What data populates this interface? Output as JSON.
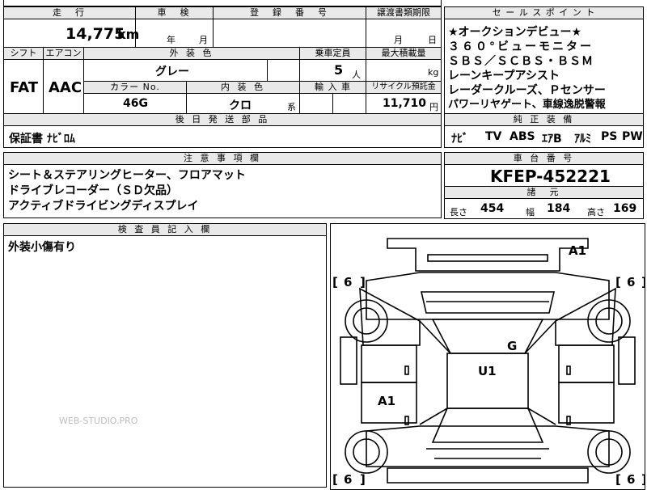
{
  "top_labels": {
    "mileage": "走　行",
    "inspection": "車　検",
    "registration": "登　録　番　号",
    "transfer_deadline": "譲渡書類期限",
    "sales_points": "セ ー ル ス ポ イ ン ト"
  },
  "top_values": {
    "mileage": "14,775",
    "mileage_unit": "km",
    "inspection_year": "年",
    "inspection_month": "月",
    "transfer_month": "月",
    "transfer_day": "日"
  },
  "row2_labels": {
    "shift": "シフト",
    "aircon": "エアコン",
    "exterior_color": "外 装 色",
    "capacity": "乗車定員",
    "max_load": "最大積載量"
  },
  "row2_values": {
    "shift": "FAT",
    "aircon": "AAC",
    "exterior_color": "グレー",
    "capacity": "5",
    "capacity_unit": "人",
    "max_load_unit": "kg"
  },
  "row3_labels": {
    "color_no": "カラー No.",
    "interior_color": "内 装 色",
    "import": "輸 入 車",
    "recycle": "リサイクル預託金"
  },
  "row3_values": {
    "color_no": "46G",
    "interior_color": "クロ",
    "interior_suffix": "系",
    "recycle": "11,710",
    "recycle_unit": "円"
  },
  "sales_points": [
    "★オークションデビュー★",
    "３６０°ビューモニター",
    "ＳＢＳ／ＳＣＢＳ・ＢＳＭ",
    "レーンキープアシスト",
    "レーダークルーズ、Ｐセンサー",
    "パワーリヤゲート、車線逸脱警報"
  ],
  "parts": {
    "label": "後 日 発 送 部 品",
    "value": "保証書 ﾅﾋﾞﾛﾑ"
  },
  "factory_equipment": {
    "label": "純 正 装 備",
    "items": [
      "ﾅﾋﾞ",
      "TV",
      "ABS",
      "ｴｱB",
      "ｱﾙﾐ",
      "PS",
      "PW"
    ]
  },
  "notes": {
    "label": "注 意 事 項 欄",
    "lines": [
      "シート＆ステアリングヒーター、フロアマット",
      "ドライブレコーダー（ＳＤ欠品）",
      "アクティブドライビングディスプレイ"
    ]
  },
  "chassis": {
    "label": "車 台 番 号",
    "value": "KFEP-452221"
  },
  "specs": {
    "label": "諸　元",
    "length_label": "長さ",
    "length": "454",
    "width_label": "幅",
    "width": "184",
    "height_label": "高さ",
    "height": "169"
  },
  "inspector": {
    "label": "検 査 員 記 入 欄",
    "comment": "外装小傷有り"
  },
  "watermark": "WEB-STUDIO.PRO",
  "diagram": {
    "marks": [
      {
        "code": "A1",
        "area": "rear-right"
      },
      {
        "code": "G",
        "area": "windshield"
      },
      {
        "code": "U1",
        "area": "roof"
      },
      {
        "code": "A1",
        "area": "left-side"
      }
    ],
    "tire_labels": [
      "6",
      "6",
      "6",
      "6"
    ]
  }
}
